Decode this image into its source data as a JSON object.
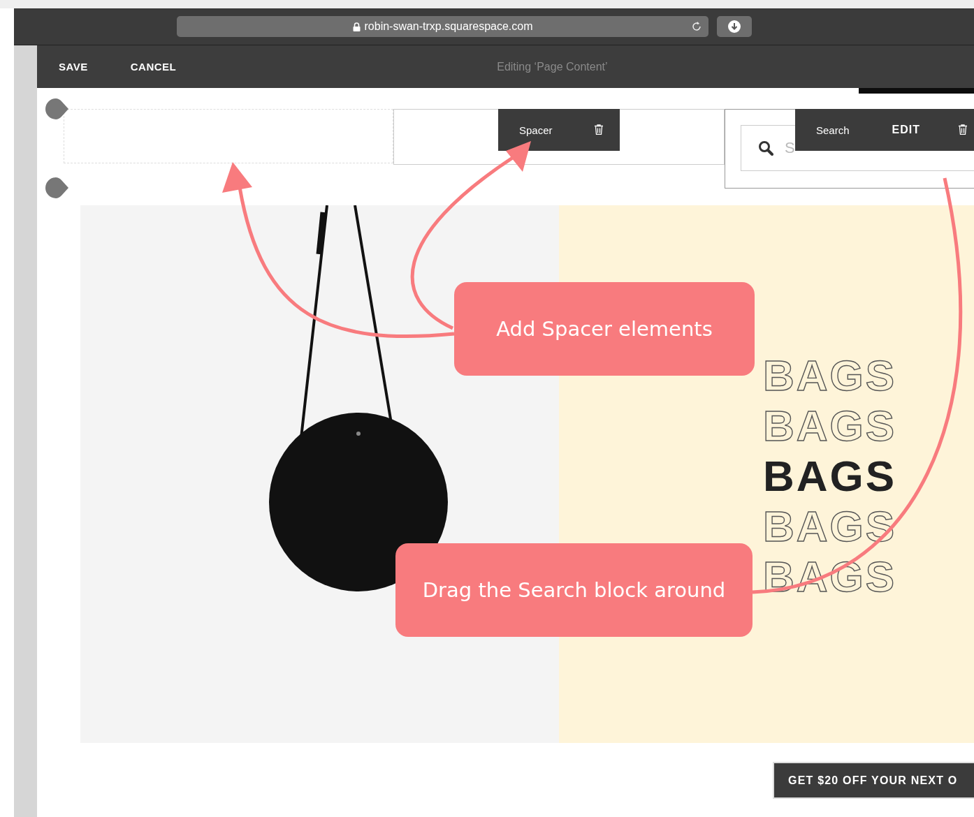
{
  "browser": {
    "url": "robin-swan-trxp.squarespace.com"
  },
  "edit_bar": {
    "buttons": [
      "SAVE",
      "CANCEL"
    ],
    "title": "Editing ‘Page Content’"
  },
  "spacer_toolbar": {
    "label": "Spacer"
  },
  "search_block": {
    "toolbar_label": "Search",
    "edit_button": "EDIT",
    "placeholder": "S"
  },
  "hero": {
    "words": [
      {
        "text": "BAGS",
        "kind": "outline"
      },
      {
        "text": "BAGS",
        "kind": "outline"
      },
      {
        "text": "BAGS",
        "kind": "solid"
      },
      {
        "text": "BAGS",
        "kind": "outline"
      },
      {
        "text": "BAGS",
        "kind": "outline"
      }
    ]
  },
  "promo_button": "GET $20 OFF YOUR NEXT O",
  "callouts": [
    "Add Spacer elements",
    "Drag the Search block around"
  ]
}
